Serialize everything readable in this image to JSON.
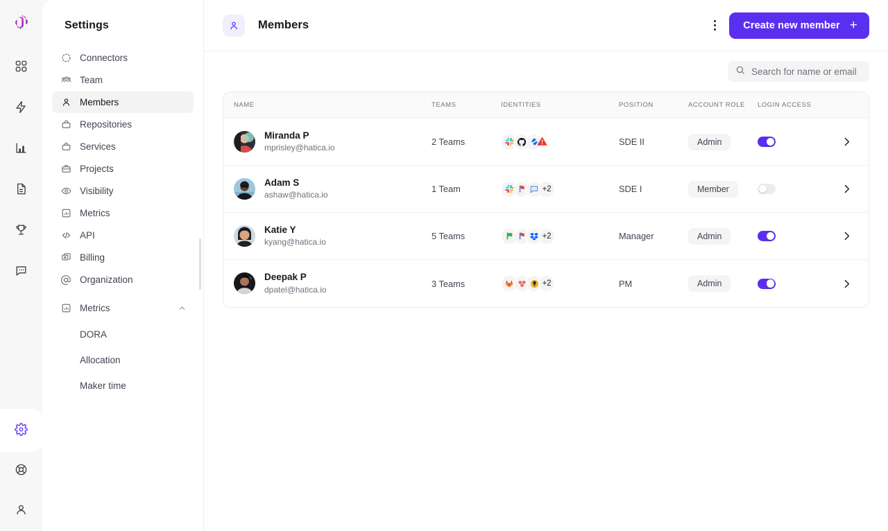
{
  "colors": {
    "accent": "#5b2ff0",
    "accent_soft": "#f1effe",
    "warning": "#e8392b",
    "text": "#17181c",
    "muted": "#6d727c"
  },
  "rail": {
    "logo": "hatica-logo",
    "items": [
      {
        "name": "dashboard-icon",
        "icon": "grid"
      },
      {
        "name": "activity-icon",
        "icon": "bolt"
      },
      {
        "name": "analytics-icon",
        "icon": "bars"
      },
      {
        "name": "documents-icon",
        "icon": "doc"
      },
      {
        "name": "goals-icon",
        "icon": "trophy"
      },
      {
        "name": "feedback-icon",
        "icon": "chat"
      }
    ],
    "bottom": [
      {
        "name": "settings-icon",
        "icon": "gear",
        "active": true
      },
      {
        "name": "support-icon",
        "icon": "lifebuoy",
        "active": false
      },
      {
        "name": "profile-icon",
        "icon": "user",
        "active": false
      }
    ]
  },
  "sidebar": {
    "title": "Settings",
    "items": [
      {
        "label": "Connectors",
        "icon": "connectors",
        "selected": false
      },
      {
        "label": "Team",
        "icon": "team",
        "selected": false
      },
      {
        "label": "Members",
        "icon": "member",
        "selected": true
      },
      {
        "label": "Repositories",
        "icon": "repo",
        "selected": false
      },
      {
        "label": "Services",
        "icon": "service",
        "selected": false
      },
      {
        "label": "Projects",
        "icon": "project",
        "selected": false
      },
      {
        "label": "Visibility",
        "icon": "eye",
        "selected": false
      },
      {
        "label": "Metrics",
        "icon": "metrics",
        "selected": false
      },
      {
        "label": "API",
        "icon": "code",
        "selected": false
      },
      {
        "label": "Billing",
        "icon": "billing",
        "selected": false
      },
      {
        "label": "Organization",
        "icon": "at",
        "selected": false
      }
    ],
    "group": {
      "label": "Metrics",
      "icon": "metrics",
      "expanded": true,
      "chevron": "chevron-up"
    },
    "sub_items": [
      {
        "label": "DORA"
      },
      {
        "label": "Allocation"
      },
      {
        "label": "Maker time"
      }
    ]
  },
  "header": {
    "icon": "member-icon",
    "title": "Members",
    "menu_icon": "kebab-menu-icon",
    "create_label": "Create new member",
    "create_plus": "+"
  },
  "search": {
    "placeholder": "Search for name or email",
    "value": "",
    "icon": "search-icon"
  },
  "table": {
    "columns": [
      "NAME",
      "TEAMS",
      "IDENTITIES",
      "POSITION",
      "ACCOUNT ROLE",
      "LOGIN ACCESS"
    ],
    "rows": [
      {
        "name": "Miranda P",
        "email": "mprisley@hatica.io",
        "avatar": "photo-1",
        "teams": "2 Teams",
        "identities": [
          "slack",
          "github",
          "jira"
        ],
        "identities_more": "",
        "warning": true,
        "position": "SDE II",
        "role": "Admin",
        "login_access": true
      },
      {
        "name": "Adam S",
        "email": "ashaw@hatica.io",
        "avatar": "photo-2",
        "teams": "1 Team",
        "identities": [
          "slack",
          "asana-flag",
          "comment"
        ],
        "identities_more": "+2",
        "warning": false,
        "position": "SDE I",
        "role": "Member",
        "login_access": false
      },
      {
        "name": "Katie Y",
        "email": "kyang@hatica.io",
        "avatar": "photo-3",
        "teams": "5 Teams",
        "identities": [
          "green-flag",
          "asana-flag",
          "dropbox"
        ],
        "identities_more": "+2",
        "warning": false,
        "position": "Manager",
        "role": "Admin",
        "login_access": true
      },
      {
        "name": "Deepak P",
        "email": "dpatel@hatica.io",
        "avatar": "photo-4",
        "teams": "3 Teams",
        "identities": [
          "gitlab",
          "asana",
          "jenkins"
        ],
        "identities_more": "+2",
        "warning": false,
        "position": "PM",
        "role": "Admin",
        "login_access": true
      }
    ]
  }
}
